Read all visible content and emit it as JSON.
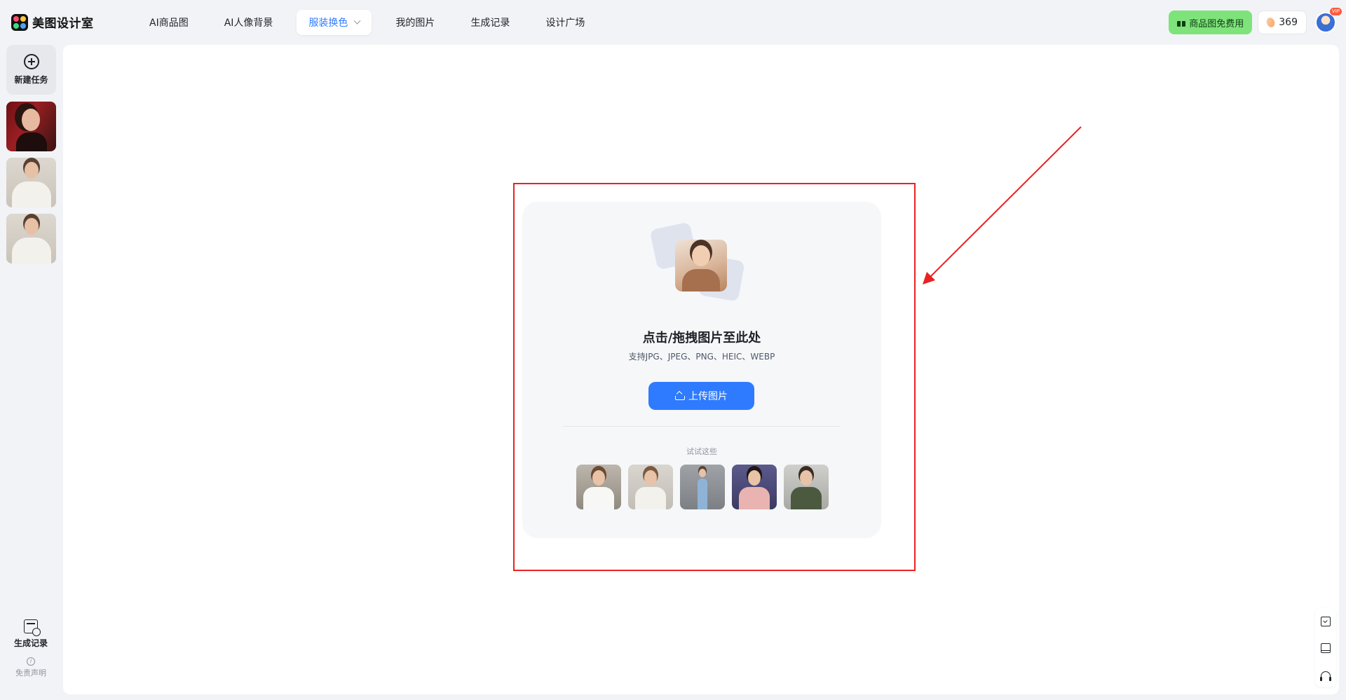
{
  "app": {
    "logo_text": "美图设计室"
  },
  "nav": {
    "items": [
      {
        "label": "AI商品图"
      },
      {
        "label": "AI人像背景"
      },
      {
        "label": "服装换色",
        "active": true,
        "has_dropdown": true
      },
      {
        "label": "我的图片"
      },
      {
        "label": "生成记录"
      },
      {
        "label": "设计广场"
      }
    ]
  },
  "header": {
    "promo_label": "商品图免费用",
    "credits": "369",
    "vip_badge": "VIP"
  },
  "sidebar": {
    "new_task_label": "新建任务",
    "history_label": "生成记录",
    "disclaimer_label": "免责声明",
    "thumbnails": [
      {
        "name": "history-thumb-red-portrait"
      },
      {
        "name": "history-thumb-white-blazer"
      },
      {
        "name": "history-thumb-white-blazer"
      }
    ]
  },
  "upload": {
    "title": "点击/拖拽图片至此处",
    "formats": "支持JPG、JPEG、PNG、HEIC、WEBP",
    "button_label": "上传图片",
    "try_label": "试试这些",
    "samples": [
      {
        "name": "sample-white-tee"
      },
      {
        "name": "sample-white-blazer"
      },
      {
        "name": "sample-denim-outfit"
      },
      {
        "name": "sample-pink-dress"
      },
      {
        "name": "sample-green-vest"
      }
    ]
  },
  "colors": {
    "accent": "#2f7bff",
    "promo_bg": "#7ee37a",
    "annotation": "#e82222"
  },
  "icons": {
    "new_task": "plus-circle-icon",
    "history": "calendar-clock-icon",
    "disclaimer": "info-icon",
    "upload": "upload-icon",
    "tools": [
      "edit-icon",
      "book-icon",
      "headset-icon"
    ]
  }
}
